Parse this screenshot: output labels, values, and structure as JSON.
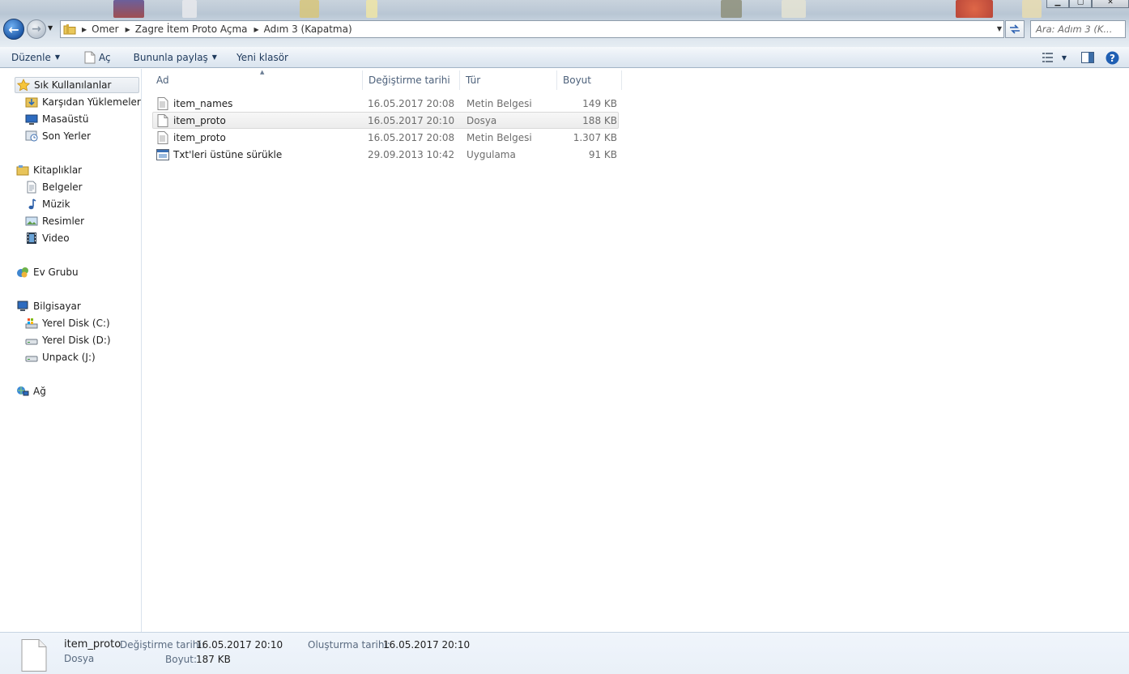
{
  "window": {
    "controls": [
      "minimize",
      "maximize",
      "close"
    ]
  },
  "address": {
    "breadcrumbs": [
      "Omer",
      "Zagre İtem Proto Açma",
      "Adım 3 (Kapatma)"
    ]
  },
  "search": {
    "placeholder": "Ara: Adım 3 (K..."
  },
  "toolbar": {
    "organize": "Düzenle",
    "open": "Aç",
    "share": "Bununla paylaş",
    "new_folder": "Yeni klasör"
  },
  "nav": {
    "favorites": {
      "label": "Sık Kullanılanlar",
      "items": [
        "Karşıdan Yüklemeler",
        "Masaüstü",
        "Son Yerler"
      ]
    },
    "libraries": {
      "label": "Kitaplıklar",
      "items": [
        "Belgeler",
        "Müzik",
        "Resimler",
        "Video"
      ]
    },
    "homegroup": {
      "label": "Ev Grubu"
    },
    "computer": {
      "label": "Bilgisayar",
      "items": [
        "Yerel Disk (C:)",
        "Yerel Disk (D:)",
        "Unpack (J:)"
      ]
    },
    "network": {
      "label": "Ağ"
    }
  },
  "columns": {
    "name": "Ad",
    "date": "Değiştirme tarihi",
    "type": "Tür",
    "size": "Boyut"
  },
  "files": [
    {
      "name": "item_names",
      "date": "16.05.2017 20:08",
      "type": "Metin Belgesi",
      "size": "149 KB",
      "icon": "text-file-icon"
    },
    {
      "name": "item_proto",
      "date": "16.05.2017 20:10",
      "type": "Dosya",
      "size": "188 KB",
      "icon": "blank-file-icon"
    },
    {
      "name": "item_proto",
      "date": "16.05.2017 20:08",
      "type": "Metin Belgesi",
      "size": "1.307 KB",
      "icon": "text-file-icon"
    },
    {
      "name": "Txt'leri üstüne sürükle",
      "date": "29.09.2013 10:42",
      "type": "Uygulama",
      "size": "91 KB",
      "icon": "application-icon"
    }
  ],
  "details": {
    "name": "item_proto",
    "type": "Dosya",
    "modified_label": "Değiştirme tarihi:",
    "modified_value": "16.05.2017 20:10",
    "size_label": "Boyut:",
    "size_value": "187 KB",
    "created_label": "Oluşturma tarihi:",
    "created_value": "16.05.2017 20:10"
  },
  "colors": {
    "accent": "#1e395b",
    "selection": "#ececec"
  }
}
